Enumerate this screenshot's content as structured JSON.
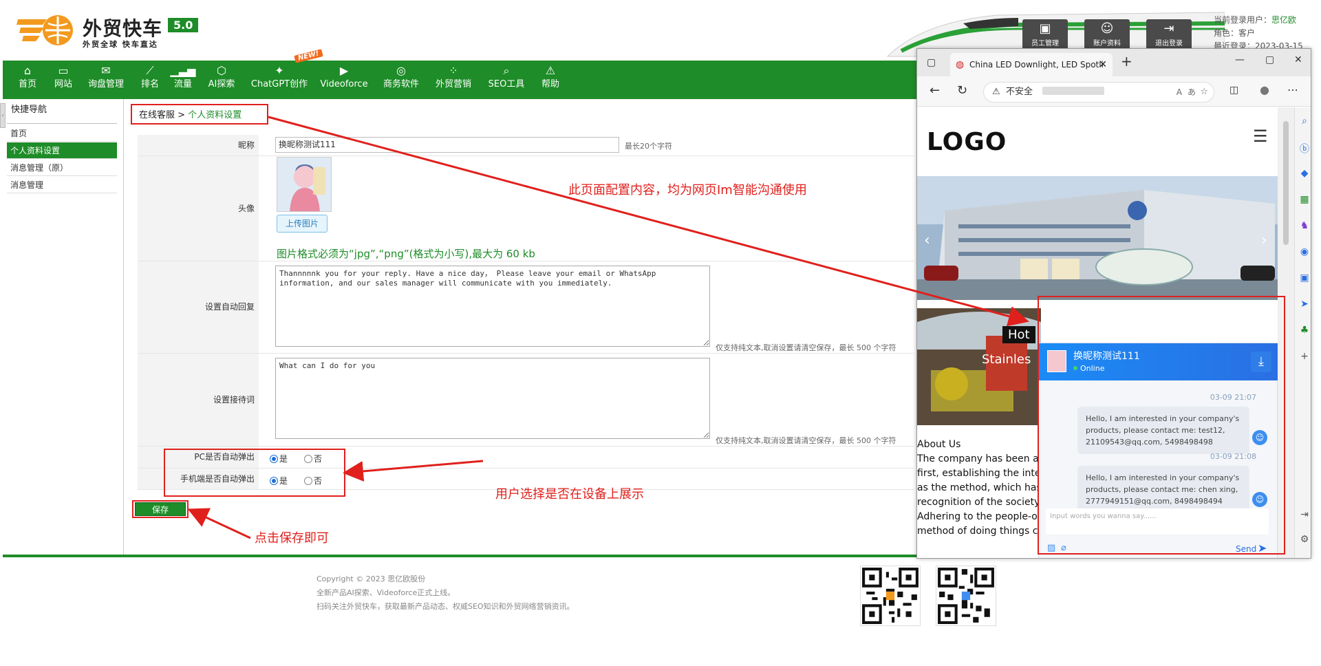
{
  "header": {
    "brand": "外贸快车",
    "version": "5.0",
    "slogan": "外贸全球 快车直达",
    "top_buttons": [
      {
        "label": "员工管理",
        "icon": "staff-icon"
      },
      {
        "label": "账户资料",
        "icon": "account-icon"
      },
      {
        "label": "退出登录",
        "icon": "logout-icon"
      }
    ],
    "user_label": "当前登录用户：",
    "user_name": "思亿欧",
    "role": "角色：客户",
    "last_login": "最近登录：2023-03-15"
  },
  "nav": {
    "new_badge": "NEW!",
    "items": [
      {
        "label": "首页",
        "icon": "home-icon"
      },
      {
        "label": "网站",
        "icon": "monitor-icon"
      },
      {
        "label": "询盘管理",
        "icon": "mail-icon"
      },
      {
        "label": "排名",
        "icon": "rank-icon"
      },
      {
        "label": "流量",
        "icon": "traffic-icon"
      },
      {
        "label": "AI探索",
        "icon": "ai-icon"
      },
      {
        "label": "ChatGPT创作",
        "icon": "chatgpt-icon"
      },
      {
        "label": "Videoforce",
        "icon": "video-icon"
      },
      {
        "label": "商务软件",
        "icon": "software-icon"
      },
      {
        "label": "外贸营销",
        "icon": "marketing-icon"
      },
      {
        "label": "SEO工具",
        "icon": "search-icon"
      },
      {
        "label": "帮助",
        "icon": "help-icon"
      }
    ]
  },
  "sidebar": {
    "title": "快捷导航",
    "items": [
      {
        "label": "首页",
        "active": false
      },
      {
        "label": "个人资料设置",
        "active": true
      },
      {
        "label": "消息管理（原）",
        "active": false
      },
      {
        "label": "消息管理",
        "active": false
      }
    ]
  },
  "breadcrumb": {
    "parent": "在线客服",
    "sep": " > ",
    "current": "个人资料设置"
  },
  "form": {
    "nickname_label": "昵称",
    "nickname_value": "换昵称测试111",
    "nickname_hint": "最长20个字符",
    "avatar_label": "头像",
    "upload_label": "上传图片",
    "image_note": "图片格式必须为“jpg”,“png”(格式为小写),最大为 60 kb",
    "auto_reply_label": "设置自动回复",
    "auto_reply_value": "Thannnnnk you for your reply. Have a nice day， Please leave your email or WhatsApp information, and our sales manager will communicate with you immediately.",
    "auto_reply_hint": "仅支持纯文本,取消设置请清空保存，最长 500 个字符",
    "greeting_label": "设置接待词",
    "greeting_value": "What can I do for you",
    "greeting_hint": "仅支持纯文本,取消设置请清空保存，最长 500 个字符",
    "pc_popup_label": "PC是否自动弹出",
    "mobile_popup_label": "手机端是否自动弹出",
    "yes": "是",
    "no": "否",
    "pc_popup": "yes",
    "mobile_popup": "yes",
    "save_label": "保存"
  },
  "annotations": {
    "top": "此页面配置内容，均为网页Im智能沟通使用",
    "device": "用户选择是否在设备上展示",
    "save": "点击保存即可"
  },
  "footer": {
    "copyright": "Copyright © 2023 思亿欧股份",
    "line2": "全新产品AI探索、Videoforce正式上线。",
    "line3": "扫码关注外贸快车，获取最新产品动态、权威SEO知识和外贸网络营销资讯。"
  },
  "browser": {
    "tab_title": "China LED Downlight, LED Spotli",
    "insecure_label": "不安全",
    "site_logo": "LOGO",
    "hot_label": "Hot",
    "stainless_label": "Stainles",
    "about_title": "About Us",
    "about_lines": [
      "The company has been adh",
      "first, establishing the integ",
      "as the method, which has v",
      "recognition of the society.",
      "Adhering to the people-ori",
      "method of doing things car"
    ]
  },
  "chat": {
    "name": "换昵称测试111",
    "status": "Online",
    "messages": [
      {
        "time": "03-09 21:07",
        "text": "Hello, I am interested in your company's products, please contact me: test12, 21109543@qq.com, 5498498498"
      },
      {
        "time": "03-09 21:08",
        "text": "Hello, I am interested in your company's products, please contact me: chen xing, 2777949151@qq.com, 8498498494"
      }
    ],
    "input_placeholder": "Input words you wanna say......",
    "send_label": "Send"
  },
  "colors": {
    "brand_green": "#1e8c28",
    "annotation_red": "#e0201c",
    "chat_blue": "#1b8bf5"
  }
}
